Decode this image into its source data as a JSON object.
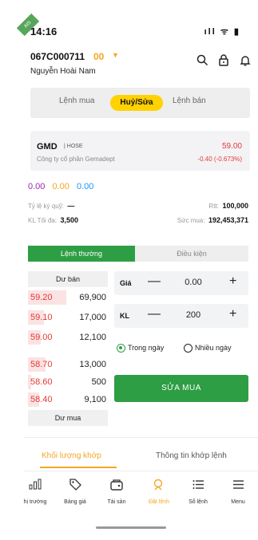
{
  "status": {
    "time": "14:16",
    "corner_badge": "AIS",
    "icons": "ıll ᯤ ▮"
  },
  "account": {
    "id": "067C000711",
    "sub_account": "00",
    "name": "Nguyễn Hoài Nam"
  },
  "header_icons": [
    "search-icon",
    "lock-icon",
    "bell-icon"
  ],
  "order_type_tabs": {
    "buy": "Lệnh mua",
    "edit": "Huỷ/Sửa",
    "sell": "Lệnh bán",
    "active": "Huỷ/Sửa"
  },
  "stock": {
    "code": "GMD",
    "exchange": "| HOSE",
    "company": "Công ty cổ phần Gemadept",
    "price": "59.00",
    "change": "-0.40 (-0.673%)"
  },
  "quick_values": [
    "0.00",
    "0.00",
    "0.00"
  ],
  "info": {
    "margin_label": "Tỷ lệ ký quỹ:",
    "margin_value": "—",
    "rtt_label": "Rtt:",
    "rtt_value": "100,000",
    "max_qty_label": "KL Tối đa:",
    "max_qty_value": "3,500",
    "buy_power_label": "Sức mua:",
    "buy_power_value": "192,453,371"
  },
  "order_mode_tabs": {
    "normal": "Lệnh thường",
    "conditional": "Điều kiện"
  },
  "order_book": {
    "sell_header": "Dư bán",
    "buy_header": "Dư mua",
    "asks": [
      {
        "price": "59.20",
        "volume": "69,900"
      },
      {
        "price": "59.10",
        "volume": "17,000"
      },
      {
        "price": "59.00",
        "volume": "12,100"
      }
    ],
    "bids": [
      {
        "price": "58.70",
        "volume": "13,000"
      },
      {
        "price": "58.60",
        "volume": "500"
      },
      {
        "price": "58.40",
        "volume": "9,100"
      }
    ]
  },
  "form": {
    "price_label": "Giá",
    "price_value": "0.00",
    "qty_label": "KL",
    "qty_value": "200",
    "minus": "—",
    "plus": "+",
    "radio_today": "Trong ngày",
    "radio_multi": "Nhiều ngày",
    "submit": "SỬA MUA"
  },
  "sub_tabs": {
    "matched_volume": "Khối lượng khớp",
    "match_info": "Thông tin khớp lệnh"
  },
  "nav": [
    {
      "icon": "chart-icon",
      "glyph": "📊",
      "label": "hị trường"
    },
    {
      "icon": "tag-icon",
      "glyph": "🏷",
      "label": "Bảng giá"
    },
    {
      "icon": "wallet-icon",
      "glyph": "👜",
      "label": "Tài sản"
    },
    {
      "icon": "order-icon",
      "glyph": "✎",
      "label": "Đặt lệnh"
    },
    {
      "icon": "list-icon",
      "glyph": "☰",
      "label": "Sổ lệnh"
    },
    {
      "icon": "menu-icon",
      "glyph": "≡",
      "label": "Menu"
    }
  ]
}
